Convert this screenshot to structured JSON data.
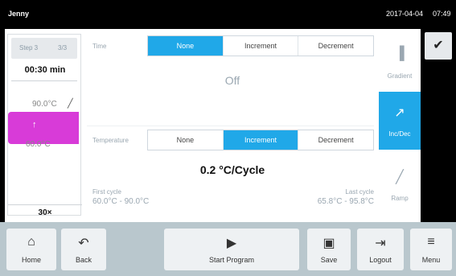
{
  "header": {
    "user": "Jenny",
    "date": "2017-04-04",
    "time": "07:49"
  },
  "step": {
    "tab_step": "Step 3",
    "tab_pages": "3/3",
    "duration": "00:30 min",
    "temp_high": "90.0°C",
    "temp_low": "60.0°C",
    "cycles": "30×",
    "bar_icon": "↑",
    "bar_color": "#d83bd8"
  },
  "time_setting": {
    "label": "Time",
    "options": [
      "None",
      "Increment",
      "Decrement"
    ],
    "selected": "None",
    "value": "Off"
  },
  "temperature_setting": {
    "label": "Temperature",
    "options": [
      "None",
      "Increment",
      "Decrement"
    ],
    "selected": "Increment",
    "value": "0.2 °C/Cycle",
    "first_cycle_label": "First cycle",
    "first_cycle_value": "60.0°C - 90.0°C",
    "last_cycle_label": "Last cycle",
    "last_cycle_value": "65.8°C - 95.8°C"
  },
  "modes": [
    {
      "label": "Gradient",
      "icon": "bars-icon",
      "glyph": "▐",
      "active": false
    },
    {
      "label": "Inc/Dec",
      "icon": "incdec-icon",
      "glyph": "↗",
      "active": true
    },
    {
      "label": "Ramp",
      "icon": "ramp-icon",
      "glyph": "╱",
      "active": false
    }
  ],
  "confirm": {
    "glyph": "✔"
  },
  "bottom_buttons": [
    {
      "label": "Home",
      "glyph": "⌂"
    },
    {
      "label": "Back",
      "glyph": "↶"
    },
    {
      "label": "Start Program",
      "glyph": "▶"
    },
    {
      "label": "Save",
      "glyph": "▣"
    },
    {
      "label": "Logout",
      "glyph": "⇥"
    },
    {
      "label": "Menu",
      "glyph": "≡"
    }
  ],
  "colors": {
    "accent": "#20a8e8",
    "bottom_bar": "#b9c7cd"
  }
}
